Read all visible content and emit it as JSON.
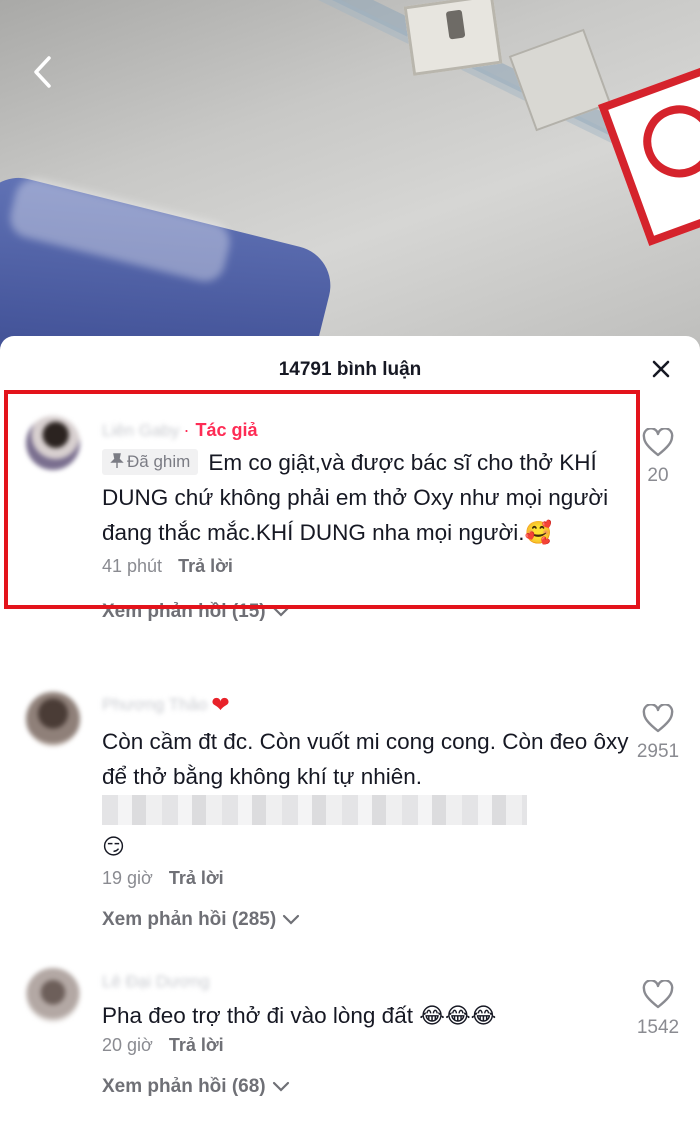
{
  "header": {
    "comment_count_title": "14791 bình luận"
  },
  "icons": {
    "back": "chevron-left-icon",
    "close": "close-icon",
    "like": "heart-outline-icon",
    "pin": "pin-icon",
    "expand": "chevron-down-icon"
  },
  "colors": {
    "accent": "#fe2c55",
    "highlight_border": "#e3131b",
    "text": "#161823",
    "muted": "#8a8b91"
  },
  "comments": [
    {
      "username": "Liên Gaby",
      "author_label": "Tác giả",
      "pinned_label": "Đã ghim",
      "text": "Em co giật,và được bác sĩ cho thở KHÍ DUNG chứ không phải em thở Oxy như mọi người đang thắc mắc.KHÍ DUNG nha mọi người.",
      "emoji": "🥰",
      "time": "41 phút",
      "reply_label": "Trả lời",
      "view_replies": "Xem phản hồi (15)",
      "likes": "20"
    },
    {
      "username": "Phương Thảo",
      "username_emoji": "❤",
      "text": "Còn cầm đt đc. Còn vuốt mi cong cong. Còn đeo ôxy để thở bằng không khí tự nhiên.",
      "emoji": "😏",
      "time": "19 giờ",
      "reply_label": "Trả lời",
      "view_replies": "Xem phản hồi (285)",
      "likes": "2951"
    },
    {
      "username": "Lê Đại Dương",
      "text": "Pha đeo trợ thở đi vào lòng đất",
      "emoji": "😂😂😂",
      "time": "20 giờ",
      "reply_label": "Trả lời",
      "view_replies": "Xem phản hồi (68)",
      "likes": "1542"
    }
  ]
}
